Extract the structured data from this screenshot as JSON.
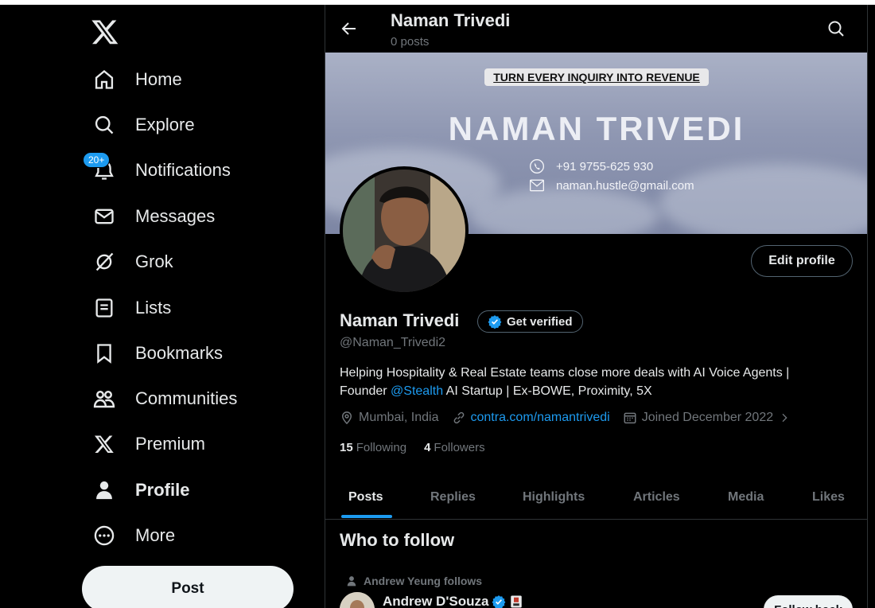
{
  "sidebar": {
    "logo": "x-logo-icon",
    "items": [
      {
        "label": "Home",
        "icon": "home-icon"
      },
      {
        "label": "Explore",
        "icon": "search-icon"
      },
      {
        "label": "Notifications",
        "icon": "bell-icon",
        "badge": "20+"
      },
      {
        "label": "Messages",
        "icon": "envelope-icon"
      },
      {
        "label": "Grok",
        "icon": "grok-icon"
      },
      {
        "label": "Lists",
        "icon": "list-icon"
      },
      {
        "label": "Bookmarks",
        "icon": "bookmark-icon"
      },
      {
        "label": "Communities",
        "icon": "people-icon"
      },
      {
        "label": "Premium",
        "icon": "x-logo-icon"
      },
      {
        "label": "Profile",
        "icon": "person-icon",
        "active": true
      },
      {
        "label": "More",
        "icon": "more-circle-icon"
      }
    ],
    "post_label": "Post"
  },
  "header": {
    "name": "Naman Trivedi",
    "post_count": "0 posts"
  },
  "banner": {
    "tagline": "TURN EVERY INQUIRY INTO REVENUE",
    "name": "NAMAN TRIVEDI",
    "phone": "+91 9755-625 930",
    "email": "naman.hustle@gmail.com"
  },
  "profile": {
    "edit_label": "Edit profile",
    "display_name": "Naman Trivedi",
    "verify_label": "Get verified",
    "handle": "@Naman_Trivedi2",
    "bio_line1": "Helping Hospitality & Real Estate teams close more deals with AI Voice Agents |",
    "bio_line2_pre": "Founder ",
    "bio_mention": "@Stealth",
    "bio_line2_post": " AI Startup | Ex-BOWE, Proximity, 5X",
    "location": "Mumbai, India",
    "website": "contra.com/namantrivedi",
    "joined": "Joined December 2022",
    "following_count": "15",
    "following_label": "Following",
    "followers_count": "4",
    "followers_label": "Followers"
  },
  "tabs": [
    "Posts",
    "Replies",
    "Highlights",
    "Articles",
    "Media",
    "Likes"
  ],
  "who_to_follow": {
    "title": "Who to follow",
    "context": "Andrew Yeung follows",
    "name": "Andrew D'Souza",
    "button": "Follow back"
  },
  "colors": {
    "accent": "#1d9bf0",
    "background": "#000000",
    "text": "#e7e9ea",
    "muted": "#71767b",
    "border": "#2f3336"
  }
}
